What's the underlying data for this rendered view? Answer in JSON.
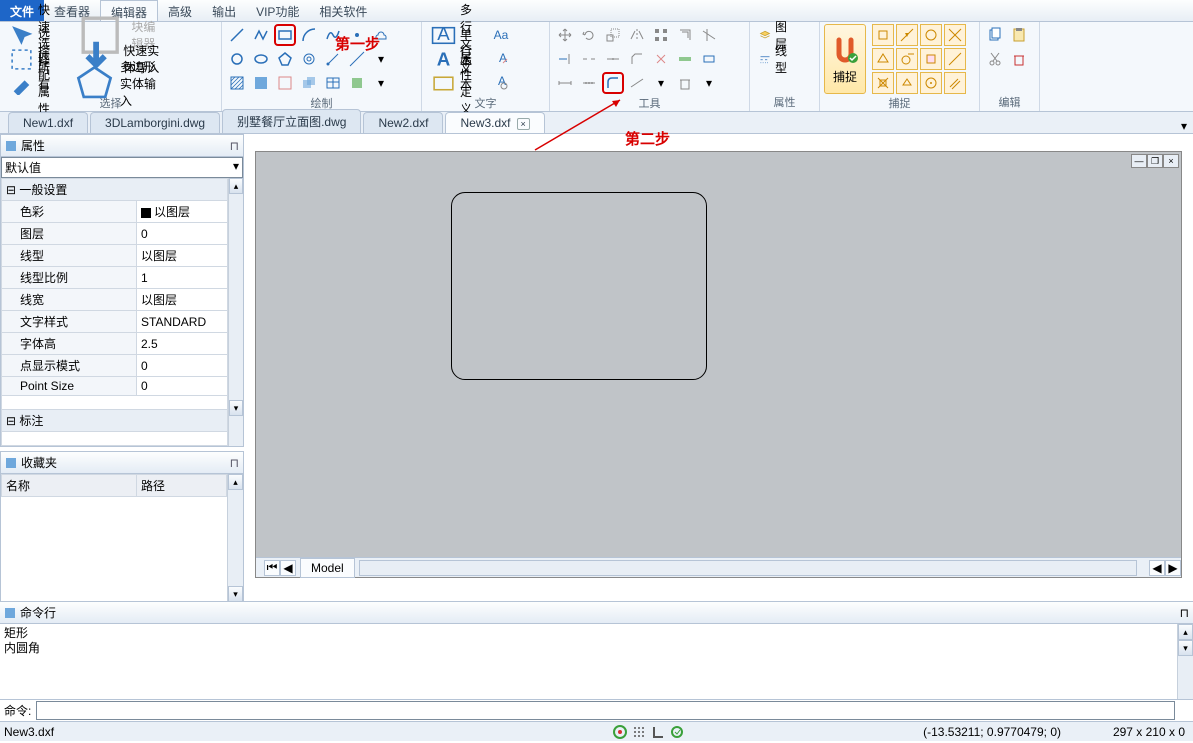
{
  "menu": {
    "file": "文件",
    "viewer": "查看器",
    "editor": "编辑器",
    "advanced": "高级",
    "output": "输出",
    "vip": "VIP功能",
    "related": "相关软件"
  },
  "ribbon": {
    "select": {
      "label": "选择",
      "quick": "快速选择",
      "block": "块编辑器",
      "all": "选择所有",
      "import": "快速实体导入",
      "match": "匹配属性",
      "poly": "多边形实体输入"
    },
    "draw": {
      "label": "绘制"
    },
    "text": {
      "label": "文字",
      "mtext": "多行文本",
      "stext": "单行文本",
      "attdef": "属性定义"
    },
    "tools": {
      "label": "工具"
    },
    "attr": {
      "label": "属性",
      "layer": "图层",
      "ltype": "线型"
    },
    "snap": {
      "label": "捕捉",
      "btn": "捕捉"
    },
    "edit": {
      "label": "编辑"
    }
  },
  "tabs": [
    "New1.dxf",
    "3DLamborgini.dwg",
    "别墅餐厅立面图.dwg",
    "New2.dxf",
    "New3.dxf"
  ],
  "activeTab": 4,
  "annotations": {
    "step1": "第一步",
    "step2": "第二步"
  },
  "propPanel": {
    "title": "属性",
    "default": "默认值",
    "general": "一般设置",
    "dim": "标注",
    "rows": [
      {
        "k": "色彩",
        "v": "以图层",
        "swatch": true
      },
      {
        "k": "图层",
        "v": "0"
      },
      {
        "k": "线型",
        "v": "以图层"
      },
      {
        "k": "线型比例",
        "v": "1"
      },
      {
        "k": "线宽",
        "v": "以图层"
      },
      {
        "k": "文字样式",
        "v": "STANDARD"
      },
      {
        "k": "字体高",
        "v": "2.5"
      },
      {
        "k": "点显示模式",
        "v": "0"
      },
      {
        "k": "Point Size",
        "v": "0"
      }
    ]
  },
  "favPanel": {
    "title": "收藏夹",
    "col1": "名称",
    "col2": "路径"
  },
  "model": "Model",
  "cmd": {
    "title": "命令行",
    "line1": "矩形",
    "line2": "内圆角",
    "prompt": "命令:"
  },
  "status": {
    "file": "New3.dxf",
    "coord": "(-13.53211; 0.9770479; 0)",
    "dim": "297 x 210 x 0"
  }
}
